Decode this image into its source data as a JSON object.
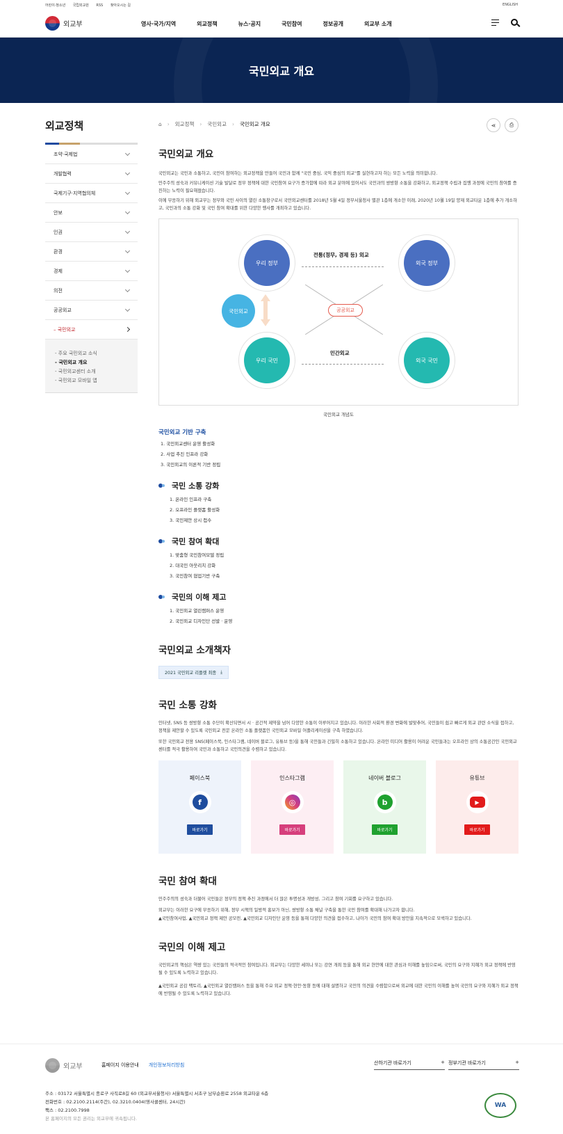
{
  "util": {
    "links": [
      "어린이·청소년",
      "국립외교원",
      "RSS",
      "찾아오시는 길"
    ],
    "english": "ENGLISH"
  },
  "header": {
    "logo": "외교부",
    "menu": [
      "영사·국가/지역",
      "외교정책",
      "뉴스·공지",
      "국민참여",
      "정보공개",
      "외교부 소개"
    ]
  },
  "hero": {
    "title": "국민외교 개요"
  },
  "sidebar": {
    "title": "외교정책",
    "items": [
      "조약·국제법",
      "개발협력",
      "국제기구·지역협의체",
      "안보",
      "인권",
      "환경",
      "경제",
      "의전",
      "공공외교",
      "국민외교"
    ],
    "active_index": 9,
    "subitems": [
      "주요 국민외교 소식",
      "국민외교 개요",
      "국민외교센터 소개",
      "국민외교 모바일 앱"
    ],
    "active_sub": 1
  },
  "breadcrumb": [
    "외교정책",
    "국민외교",
    "국민외교 개요"
  ],
  "intro": {
    "title": "국민외교 개요",
    "p1": "국민외교는 국민과 소통하고, 국민이 참여하는 외교정책을 만들어 국민과 함께 \"국민 중심, 국익 중심의 외교\"를 실현하고자 하는 모든 노력을 의미합니다.",
    "p2": "민주주의 성숙과 커뮤니케이션 기술 발달로 정부 정책에 대한 국민참여 요구가 증가함에 따라 외교 분야에 있어서도 국민과의 쌍방향 소통을 강화하고, 외교정책 수립과 집행 과정에 국민의 참여를 증진하는 노력이 필요해졌습니다.",
    "p3": "이에 부응하기 위해 외교부는 정부와 국민 사이의 열린 소통창구로서 국민외교센터를 2018년 5월 4일 정부서울청사 별관 1층에 개소한 이래, 2020년 10월 19일 양재 외교타운 1층에 추가 개소하고, 국민과의 소통 강화 및 국민 참여 확대를 위한 다양한 행사를 개최하고 있습니다."
  },
  "diagram": {
    "our_gov": "우리 정부",
    "foreign_gov": "외국 정부",
    "our_people": "우리 국민",
    "foreign_people": "외국 국민",
    "people_diplomacy": "국민외교",
    "public_diplomacy": "공공외교",
    "traditional": "전통(정무, 경제 등) 외교",
    "civil": "민간외교",
    "caption": "국민외교 개념도",
    "colors": {
      "blue": "#4a6fc1",
      "teal": "#24b9b0",
      "sky": "#46b4e3",
      "red": "#e45a4d"
    }
  },
  "base": {
    "title": "국민외교 기반 구축",
    "items": [
      "1. 국민외교센터 운영 활성화",
      "2. 사업 추진 인프라 강화",
      "3. 국민외교의 이론적 기반 정립"
    ]
  },
  "sections": [
    {
      "title": "국민 소통 강화",
      "items": [
        "1. 온라인 인프라 구축",
        "2. 오프라인 플랫폼 활성화",
        "3. 국민제안 상시 접수"
      ]
    },
    {
      "title": "국민 참여 확대",
      "items": [
        "1. 맞춤형 국민참여모델 정립",
        "2. 대국민 아웃리치 강화",
        "3. 국민참여 협업기반 구축"
      ]
    },
    {
      "title": "국민의 이해 제고",
      "items": [
        "1. 국민외교 열린캠퍼스 운영",
        "2. 국민외교 디자인단 선발 · 운영"
      ]
    }
  ],
  "booklet": {
    "title": "국민외교 소개책자",
    "download": "2021 국민외교 리플렛 최종"
  },
  "comm": {
    "title": "국민 소통 강화",
    "p1": "인터넷, SNS 등 쌍방향 소통 수단이 확산되면서 시 · 공간적 제약을 넘어 다양한 소통이 이루어지고 있습니다. 이러한 사회적 환경 변화에 발맞추어, 국민들이 쉽고 빠르게 외교 관련 소식을 접하고, 정책을 제안할 수 있도록 국민외교 전문 온라인 소통 플랫폼인 국민외교 모바일 어플리케이션을 구축 하였습니다.",
    "p2": "또한 국민외교 전용 SNS(페이스북, 인스타그램, 네이버 블로그, 유튜브 등)을 통해 국민들과 긴밀히 소통하고 있습니다. 온라인 미디어 활용이 어려운 국민들과는 오프라인 상의 소통공간인 국민외교센터를 적극 활용하여 국민과 소통하고 국민의견을 수렴하고 있습니다.",
    "sns": [
      {
        "name": "페이스북",
        "icon": "facebook-icon",
        "glyph": "f",
        "go": "바로가기",
        "bg": "#eef3fb",
        "color": "#1f4d9e"
      },
      {
        "name": "인스타그램",
        "icon": "instagram-icon",
        "glyph": "◎",
        "go": "바로가기",
        "bg": "#fdeef3",
        "color": "#d63f7c"
      },
      {
        "name": "네이버 블로그",
        "icon": "naver-blog-icon",
        "glyph": "b",
        "go": "바로가기",
        "bg": "#e9f7ea",
        "color": "#1fa12f"
      },
      {
        "name": "유튜브",
        "icon": "youtube-icon",
        "glyph": "▶",
        "go": "바로가기",
        "bg": "#fdeceb",
        "color": "#e21b1b"
      }
    ]
  },
  "participate": {
    "title": "국민 참여 확대",
    "p1": "민주주의의 성숙과 더불어 국민들은 정부의 정책 추진 과정에서 더 많은 투명성과 개방성, 그리고 참여 기회를 요구하고 있습니다.",
    "p2": "외교부는 이러한 요구에 부응하기 위해, 정부 시책의 일방적 홍보가 아닌, 쌍방향 소통 채널 구축을 통한 국민 참여를 확대해 나가고자 합니다.",
    "p3": "▲국민참여사업, ▲국민외교 정책 제안 공모전, ▲국민외교 디자인단 운영 등을 통해 다양한 의견을 접수하고, 나아가 국민의 참여 확대 방안을 지속적으로 모색하고 있습니다."
  },
  "understand": {
    "title": "국민의 이해 제고",
    "p1": "국민외교의 핵심은 역량 있는 국민들의 적극적인 참여입니다. 외교부는 다양한 세미나 또는 강연 개최 등을 통해 외교 현안에 대한 관심과 이해를 높임으로써, 국민의 요구와 지혜가 외교 정책에 반영될 수 있도록 노력하고 있습니다.",
    "p2": "▲국민외교 공감 팩토리, ▲국민외교 열린캠퍼스 등을 통해 주요 외교 정책·현안·동향 등에 대해 설명하고 국민의 의견을 수렴함으로써 외교에 대한 국민의 이해를 높여 국민의 요구와 지혜가 외교 정책에 반영될 수 있도록 노력하고 있습니다."
  },
  "footer": {
    "logo": "외교부",
    "link1": "홈페이지 이용안내",
    "link2": "개인정보처리방침",
    "sel1": "산하기관 바로가기",
    "sel2": "정부기관 바로가기",
    "addr": "주소 : 03172 서울특별시 종로구 사직로8길 60 (외교부서울청사) 서울특별시 서초구 남부순환로 2558 외교타운 6층",
    "tel": "전화번호 : 02.2100.2114(주간), 02.3210.0404(영사콜센터, 24시간)",
    "fax": "팩스 : 02.2100.7998",
    "copy": "본 홈페이지의 모든 권리는 외교부에 귀속됩니다.",
    "wa": "WA"
  }
}
